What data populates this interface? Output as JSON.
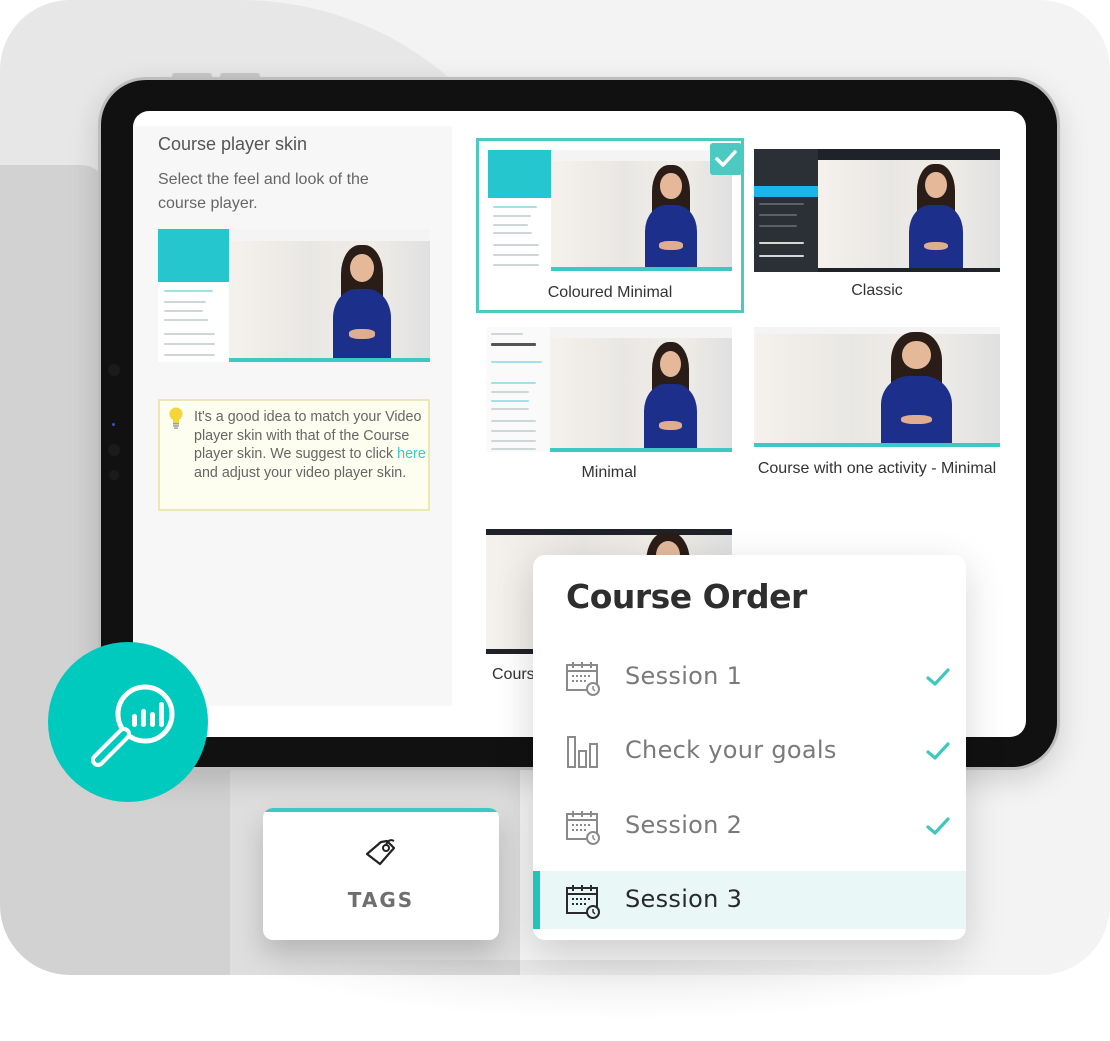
{
  "left_panel": {
    "title": "Course player skin",
    "subtitle": "Select the feel and look of the course player.",
    "tip": {
      "text_before": "It's a good idea to match your Video player skin with that of the Course player skin. We suggest to click ",
      "link": "here",
      "text_after": " and adjust your video player skin."
    }
  },
  "skins": [
    {
      "label": "Coloured Minimal",
      "selected": true
    },
    {
      "label": "Classic",
      "selected": false
    },
    {
      "label": "Minimal",
      "selected": false
    },
    {
      "label": "Course with one activity - Minimal",
      "selected": false
    },
    {
      "label": "Cours",
      "selected": false
    }
  ],
  "icons": {
    "search_circle": "search-analytics-icon",
    "tip": "lightbulb-icon",
    "tags": "tag-icon",
    "session": "calendar-clock-icon",
    "goals": "bar-chart-icon",
    "check": "check-icon"
  },
  "tags_card": {
    "label": "TAGS"
  },
  "course_order": {
    "title": "Course Order",
    "items": [
      {
        "label": "Session 1",
        "icon": "calendar-clock-icon",
        "completed": true,
        "active": false
      },
      {
        "label": "Check your goals",
        "icon": "bar-chart-icon",
        "completed": true,
        "active": false
      },
      {
        "label": "Session 2",
        "icon": "calendar-clock-icon",
        "completed": true,
        "active": false
      },
      {
        "label": "Session 3",
        "icon": "calendar-clock-icon",
        "completed": false,
        "active": true
      }
    ]
  },
  "colors": {
    "accent": "#00c9be",
    "selected_border": "#4cc9c0",
    "active_row_bg": "#e9f8f6",
    "link": "#3cc8c3"
  }
}
